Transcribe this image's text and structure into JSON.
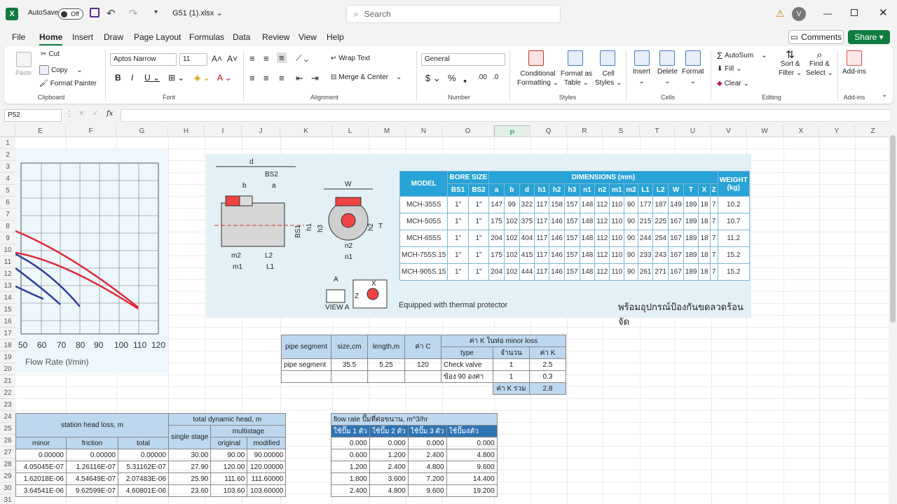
{
  "titlebar": {
    "autosave": "AutoSave",
    "toggle": "Off",
    "filename": "G51 (1).xlsx",
    "search_placeholder": "Search",
    "user_initial": "V"
  },
  "menu": [
    "File",
    "Home",
    "Insert",
    "Draw",
    "Page Layout",
    "Formulas",
    "Data",
    "Review",
    "View",
    "Help"
  ],
  "buttons": {
    "comments": "Comments",
    "share": "Share"
  },
  "ribbon": {
    "paste": "Paste",
    "cut": "Cut",
    "copy": "Copy",
    "format_painter": "Format Painter",
    "clipboard": "Clipboard",
    "font_name": "Aptos Narrow",
    "font_size": "11",
    "font": "Font",
    "wrap_text": "Wrap Text",
    "merge_center": "Merge & Center",
    "alignment": "Alignment",
    "number_format": "General",
    "number": "Number",
    "conditional": "Conditional",
    "formatting": "Formatting",
    "format_as": "Format as",
    "table": "Table",
    "cell": "Cell",
    "styles_btn": "Styles",
    "styles": "Styles",
    "insert": "Insert",
    "delete": "Delete",
    "format": "Format",
    "cells": "Cells",
    "autosum": "AutoSum",
    "fill": "Fill",
    "clear": "Clear",
    "sort": "Sort &",
    "filter": "Filter",
    "find": "Find &",
    "select": "Select",
    "editing": "Editing",
    "addins": "Add-ins",
    "addins_grp": "Add-ins"
  },
  "formula": {
    "namebox": "P52",
    "fx": "fx"
  },
  "columns": [
    "E",
    "F",
    "G",
    "H",
    "I",
    "J",
    "K",
    "L",
    "M",
    "N",
    "O",
    "P",
    "Q",
    "R",
    "S",
    "T",
    "U",
    "V",
    "W",
    "X",
    "Y",
    "Z"
  ],
  "rows": [
    "1",
    "2",
    "3",
    "4",
    "5",
    "6",
    "7",
    "8",
    "9",
    "10",
    "11",
    "12",
    "13",
    "14",
    "15",
    "16",
    "17",
    "18",
    "19",
    "20",
    "21",
    "22",
    "23",
    "24",
    "25",
    "26",
    "27",
    "28",
    "29",
    "30",
    "31"
  ],
  "chart": {
    "xticks": [
      "50",
      "60",
      "70",
      "80",
      "90",
      "100",
      "110",
      "120"
    ],
    "xlabel": "Flow Rate (l/min)"
  },
  "pump": {
    "labels": [
      "d",
      "BS2",
      "b",
      "a",
      "W",
      "BS1",
      "h1",
      "h3",
      "h2",
      "T",
      "m2",
      "L2",
      "m1",
      "L1",
      "n2",
      "n1",
      "A",
      "VIEW A",
      "X",
      "Z"
    ],
    "footer_en": "Equipped with thermal protector",
    "footer_th": "พร้อมอุปกรณ์ป้องกันขดลวดร้อนจัด"
  },
  "spec": {
    "h_model": "MODEL",
    "h_bore": "BORE SIZE",
    "h_dim": "DIMENSIONS (mm)",
    "h_weight": "WEIGHT",
    "h_kg": "(kg)",
    "sub": [
      "BS1",
      "BS2",
      "a",
      "b",
      "d",
      "h1",
      "h2",
      "h3",
      "n1",
      "n2",
      "m1",
      "m2",
      "L1",
      "L2",
      "W",
      "T",
      "X",
      "Z"
    ],
    "rows": [
      [
        "MCH-355S",
        "1\"",
        "1\"",
        "147",
        "99",
        "322",
        "117",
        "158",
        "157",
        "148",
        "112",
        "110",
        "90",
        "177",
        "187",
        "149",
        "189",
        "18",
        "7",
        "10.2"
      ],
      [
        "MCH-505S",
        "1\"",
        "1\"",
        "175",
        "102",
        "375",
        "117",
        "146",
        "157",
        "148",
        "112",
        "110",
        "90",
        "215",
        "225",
        "167",
        "189",
        "18",
        "7",
        "10.7"
      ],
      [
        "MCH-655S",
        "1\"",
        "1\"",
        "204",
        "102",
        "404",
        "117",
        "146",
        "157",
        "148",
        "112",
        "110",
        "90",
        "244",
        "254",
        "167",
        "189",
        "18",
        "7",
        "11.2"
      ],
      [
        "MCH-755S.15",
        "1\"",
        "1\"",
        "175",
        "102",
        "415",
        "117",
        "146",
        "157",
        "148",
        "112",
        "110",
        "90",
        "233",
        "243",
        "167",
        "189",
        "18",
        "7",
        "15.2"
      ],
      [
        "MCH-905S.15",
        "1\"",
        "1\"",
        "204",
        "102",
        "444",
        "117",
        "146",
        "157",
        "148",
        "112",
        "110",
        "90",
        "261",
        "271",
        "167",
        "189",
        "18",
        "7",
        "15.2"
      ]
    ]
  },
  "pipe": {
    "h1": "pipe segment",
    "h2": "size,cm",
    "h3": "length,m",
    "h4": "ค่า C",
    "h5": "ค่า K ในท่อ minor loss",
    "t1": "type",
    "t2": "จำนวน",
    "t3": "ค่า K",
    "r1": [
      "pipe segment",
      "35.5",
      "5.25",
      "120",
      "Check valve",
      "1",
      "2.5"
    ],
    "r2": [
      "ข้อง 90 องศา",
      "1",
      "0.3"
    ],
    "sum_label": "ค่า K รวม",
    "sum": "2.8"
  },
  "head": {
    "station": "station head loss, m",
    "tdh": "total dynamic head, m",
    "single": "single stage",
    "multi": "multistage",
    "minor": "minor",
    "friction": "friction",
    "total": "total",
    "original": "original",
    "modified": "modified",
    "rows": [
      [
        "0.00000",
        "0.00000",
        "0.00000",
        "30.00",
        "90.00",
        "90.00000"
      ],
      [
        "4.05045E-07",
        "1.26116E-07",
        "5.31162E-07",
        "27.90",
        "120.00",
        "120.00000"
      ],
      [
        "1.62018E-06",
        "4.54649E-07",
        "2.07483E-06",
        "25.90",
        "111.60",
        "111.60000"
      ],
      [
        "3.64541E-06",
        "9.62599E-07",
        "4.60801E-06",
        "23.60",
        "103.60",
        "103.60000"
      ]
    ]
  },
  "flow": {
    "title": "flow rate ปั๊มที่ต่อขนาน, m^3/hr",
    "cols": [
      "ใช้ปั๊ม 1 ตัว",
      "ใช้ปั๊ม 2 ตัว",
      "ใช้ปั๊ม 3 ตัว",
      "ใช้ปั๊ม4ตัว"
    ],
    "rows": [
      [
        "0.000",
        "0.000",
        "0.000",
        "0.000"
      ],
      [
        "0.600",
        "1.200",
        "2.400",
        "4.800"
      ],
      [
        "1.200",
        "2.400",
        "4.800",
        "9.600"
      ],
      [
        "1.800",
        "3.600",
        "7.200",
        "14.400"
      ],
      [
        "2.400",
        "4.800",
        "9.600",
        "19.200"
      ]
    ]
  }
}
